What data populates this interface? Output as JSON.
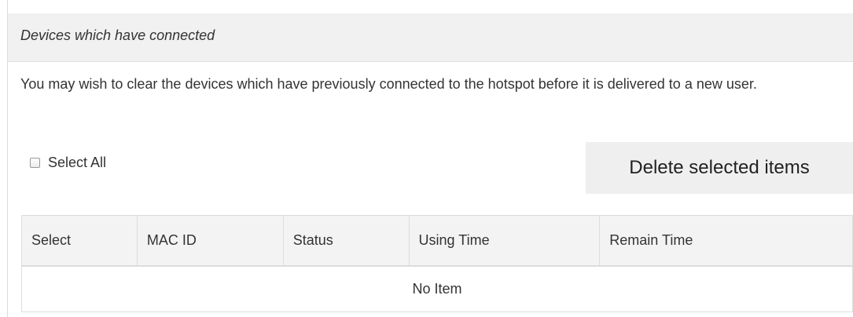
{
  "panel": {
    "title": "Devices which have connected"
  },
  "intro_text": "You may wish to clear the devices which have previously connected to the hotspot before it is delivered to a new user.",
  "select_all": {
    "label": "Select All",
    "checked": false
  },
  "delete_button_label": "Delete selected items",
  "table": {
    "columns": [
      "Select",
      "MAC ID",
      "Status",
      "Using Time",
      "Remain Time"
    ],
    "empty_text": "No Item"
  }
}
